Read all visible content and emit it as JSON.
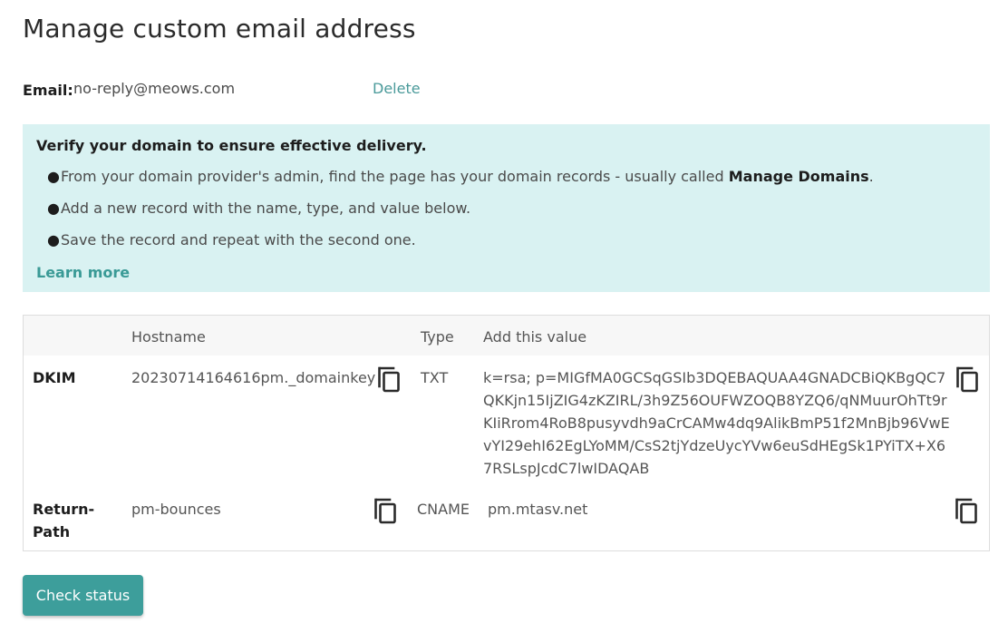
{
  "page": {
    "title": "Manage custom email address"
  },
  "email": {
    "label": "Email:",
    "value": "no-reply@meows.com",
    "delete_label": "Delete"
  },
  "notice": {
    "heading": "Verify your domain to ensure effective delivery.",
    "items": [
      {
        "bullet": "●",
        "text": "From your domain provider's admin, find the page has your domain records - usually called ",
        "emphasis": "Manage Domains",
        "suffix": "."
      },
      {
        "bullet": "●",
        "text": "Add a new record with the name, type, and value below."
      },
      {
        "bullet": "●",
        "text": "Save the record and repeat with the second one."
      }
    ],
    "learn_more": "Learn more"
  },
  "records_table": {
    "headers": {
      "hostname": "Hostname",
      "type": "Type",
      "value": "Add this value"
    },
    "rows": [
      {
        "name": "DKIM",
        "hostname": "20230714164616pm._domainkey",
        "type": "TXT",
        "value": "k=rsa; p=MIGfMA0GCSqGSIb3DQEBAQUAA4GNADCBiQKBgQC7QKKjn15IjZIG4zKZIRL/3h9Z56OUFWZOQB8YZQ6/qNMuurOhTt9rKIiRrom4RoB8pusyvdh9aCrCAMw4dq9AlikBmP51f2MnBjb96VwEvYI29ehI62EgLYoMM/CsS2tjYdzeUycYVw6euSdHEgSk1PYiTX+X67RSLspJcdC7lwIDAQAB"
      },
      {
        "name": "Return-Path",
        "hostname": "pm-bounces",
        "type": "CNAME",
        "value": "pm.mtasv.net"
      }
    ]
  },
  "actions": {
    "check_status": "Check status"
  },
  "icons": {
    "copy": "copy-icon",
    "bullet": "bullet"
  },
  "colors": {
    "accent": "#3d9e9b",
    "link": "#4a9a9a",
    "notice_background": "#d9f2f2",
    "table_header_background": "#f7f7f7"
  }
}
